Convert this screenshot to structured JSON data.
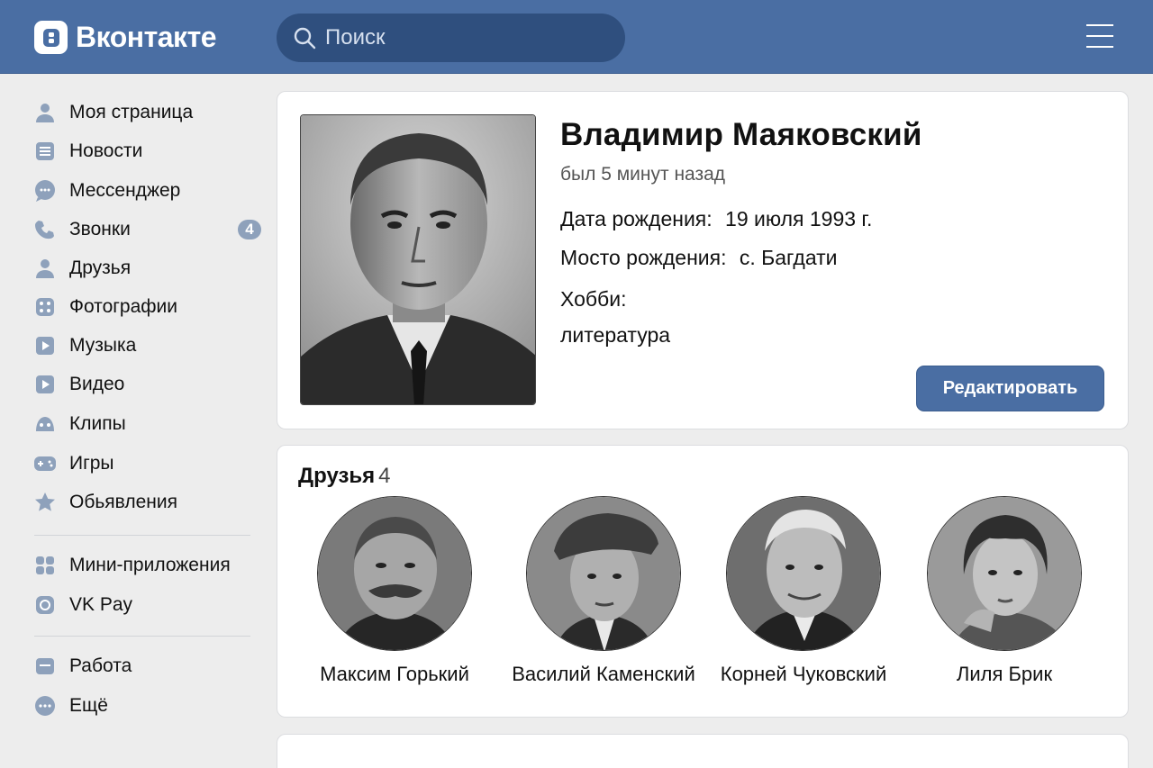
{
  "header": {
    "logo_text": "Вконтакте",
    "search_placeholder": "Поиск",
    "brand_color": "#4a6ea3"
  },
  "sidebar": {
    "items": [
      {
        "label": "Моя страница",
        "icon": "user-icon"
      },
      {
        "label": "Новости",
        "icon": "news-icon"
      },
      {
        "label": "Мессенджер",
        "icon": "chat-icon"
      },
      {
        "label": "Звонки",
        "icon": "phone-icon",
        "badge": "4"
      },
      {
        "label": "Друзья",
        "icon": "friends-icon"
      },
      {
        "label": "Фотографии",
        "icon": "photos-icon"
      },
      {
        "label": "Музыка",
        "icon": "music-icon"
      },
      {
        "label": "Видео",
        "icon": "video-icon"
      },
      {
        "label": "Клипы",
        "icon": "clips-icon"
      },
      {
        "label": "Игры",
        "icon": "games-icon"
      },
      {
        "label": "Обьявления",
        "icon": "star-icon"
      },
      {
        "label": "Мини-приложения",
        "icon": "apps-icon"
      },
      {
        "label": "VK Pay",
        "icon": "vkpay-icon"
      },
      {
        "label": "Работа",
        "icon": "work-icon"
      },
      {
        "label": "Ещё",
        "icon": "more-icon"
      }
    ]
  },
  "profile": {
    "name": "Владимир Маяковский",
    "status": "был 5 минут назад",
    "birth_date_label": "Дата рождения:",
    "birth_date_value": "19 июля 1993 г.",
    "birth_place_label": "Мосто рождения:",
    "birth_place_value": "с. Багдати",
    "hobby_label": "Хобби:",
    "hobby_value": "литература",
    "edit_button": "Редактировать"
  },
  "friends": {
    "title": "Друзья",
    "count": "4",
    "list": [
      {
        "name": "Максим Горький"
      },
      {
        "name": "Василий Каменский"
      },
      {
        "name": "Корней Чуковский"
      },
      {
        "name": "Лиля Брик"
      }
    ]
  }
}
